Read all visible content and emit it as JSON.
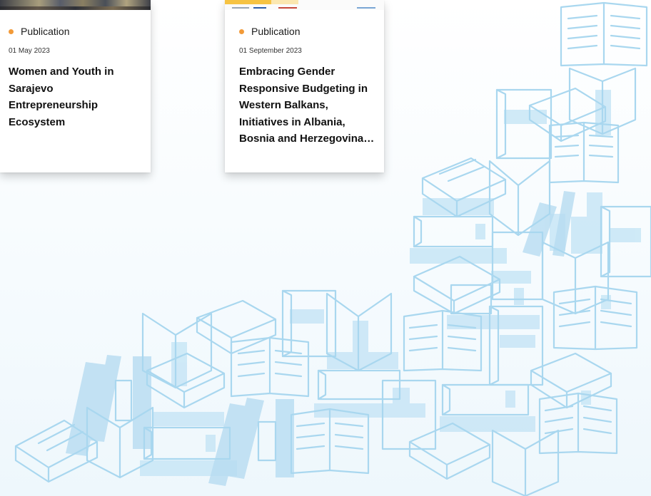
{
  "colors": {
    "tag_dot": "#f29a38",
    "book_line": "#a9d7ef",
    "book_fill": "#c8e6f6"
  },
  "cards": [
    {
      "tag": "Publication",
      "date": "01 May 2023",
      "title": "Women and Youth in Sarajevo Entrepreneurship Ecosystem"
    },
    {
      "tag": "Publication",
      "date": "01 September 2023",
      "title": "Embracing Gender Responsive Budgeting in Western Balkans, Initiatives in Albania, Bosnia and Herzegovina…"
    }
  ],
  "background": {
    "icon": "books-illustration"
  }
}
